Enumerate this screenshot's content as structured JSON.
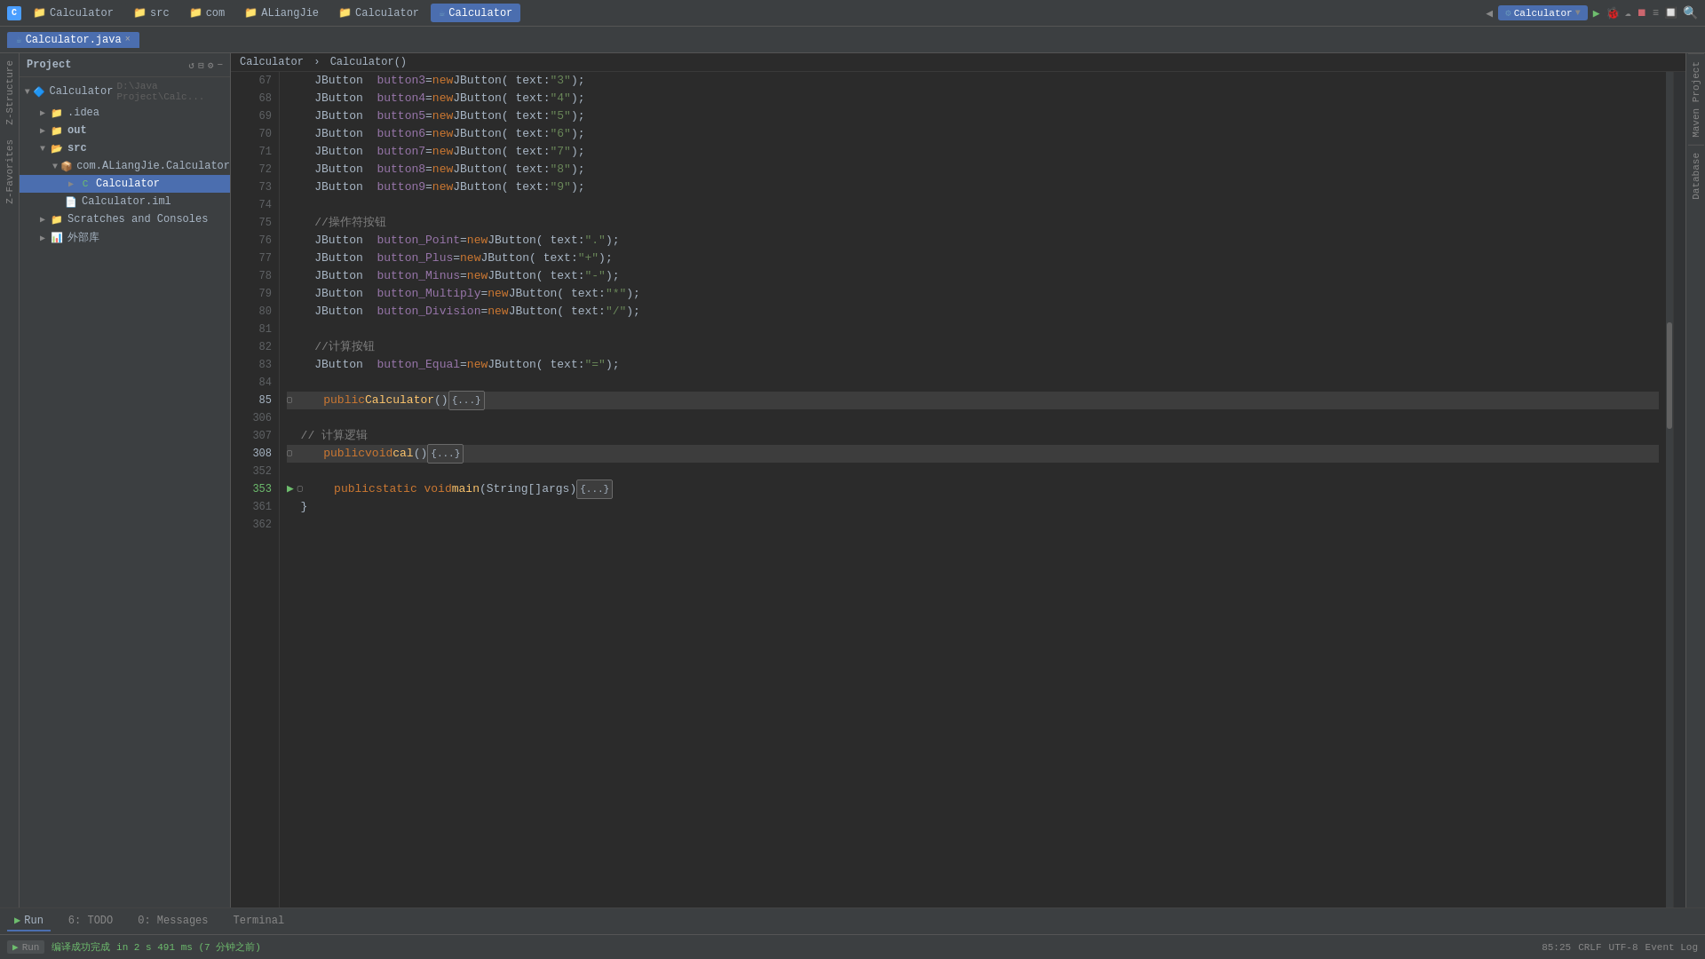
{
  "topbar": {
    "app_icon": "C",
    "tabs": [
      {
        "label": "Calculator",
        "type": "folder",
        "active": false
      },
      {
        "label": "src",
        "type": "folder",
        "active": false
      },
      {
        "label": "com",
        "type": "folder",
        "active": false
      },
      {
        "label": "ALiangJie",
        "type": "folder",
        "active": false
      },
      {
        "label": "Calculator",
        "type": "folder",
        "active": false
      },
      {
        "label": "Calculator",
        "type": "file",
        "active": true
      }
    ],
    "run_config": "Calculator",
    "run_btn": "▶",
    "debug_btn": "🐞"
  },
  "toolbar": {
    "file_tab": "Calculator.java",
    "close": "×"
  },
  "sidebar": {
    "header": "Project",
    "tree": [
      {
        "level": 0,
        "label": "Calculator  D:\\Java Project\\Calc...",
        "icon": "project",
        "expanded": true
      },
      {
        "level": 1,
        "label": ".idea",
        "icon": "folder",
        "expanded": false
      },
      {
        "level": 1,
        "label": "out",
        "icon": "folder",
        "expanded": false
      },
      {
        "level": 1,
        "label": "src",
        "icon": "folder",
        "expanded": true
      },
      {
        "level": 2,
        "label": "com.ALiangJie.Calculator",
        "icon": "package",
        "expanded": true
      },
      {
        "level": 3,
        "label": "Calculator",
        "icon": "class",
        "expanded": false
      },
      {
        "level": 3,
        "label": "Calculator.iml",
        "icon": "file",
        "expanded": false
      },
      {
        "level": 1,
        "label": "Scratches and Consoles",
        "icon": "folder",
        "expanded": false
      },
      {
        "level": 1,
        "label": "外部库",
        "icon": "lib",
        "expanded": false
      }
    ]
  },
  "code": {
    "lines": [
      {
        "num": "67",
        "content": [
          {
            "t": "plain",
            "v": "    JButton  "
          },
          {
            "t": "var",
            "v": "button3"
          },
          {
            "t": "plain",
            "v": "= "
          },
          {
            "t": "kw",
            "v": "new"
          },
          {
            "t": "plain",
            "v": " JButton( text: "
          },
          {
            "t": "str",
            "v": "\"3\""
          },
          {
            "t": "plain",
            "v": ");"
          }
        ]
      },
      {
        "num": "68",
        "content": [
          {
            "t": "plain",
            "v": "    JButton  "
          },
          {
            "t": "var",
            "v": "button4"
          },
          {
            "t": "plain",
            "v": "= "
          },
          {
            "t": "kw",
            "v": "new"
          },
          {
            "t": "plain",
            "v": " JButton( text: "
          },
          {
            "t": "str",
            "v": "\"4\""
          },
          {
            "t": "plain",
            "v": ");"
          }
        ]
      },
      {
        "num": "69",
        "content": [
          {
            "t": "plain",
            "v": "    JButton  "
          },
          {
            "t": "var",
            "v": "button5"
          },
          {
            "t": "plain",
            "v": "= "
          },
          {
            "t": "kw",
            "v": "new"
          },
          {
            "t": "plain",
            "v": " JButton( text: "
          },
          {
            "t": "str",
            "v": "\"5\""
          },
          {
            "t": "plain",
            "v": ");"
          }
        ]
      },
      {
        "num": "70",
        "content": [
          {
            "t": "plain",
            "v": "    JButton  "
          },
          {
            "t": "var",
            "v": "button6"
          },
          {
            "t": "plain",
            "v": "= "
          },
          {
            "t": "kw",
            "v": "new"
          },
          {
            "t": "plain",
            "v": " JButton( text: "
          },
          {
            "t": "str",
            "v": "\"6\""
          },
          {
            "t": "plain",
            "v": ");"
          }
        ]
      },
      {
        "num": "71",
        "content": [
          {
            "t": "plain",
            "v": "    JButton  "
          },
          {
            "t": "var",
            "v": "button7"
          },
          {
            "t": "plain",
            "v": "= "
          },
          {
            "t": "kw",
            "v": "new"
          },
          {
            "t": "plain",
            "v": " JButton( text: "
          },
          {
            "t": "str",
            "v": "\"7\""
          },
          {
            "t": "plain",
            "v": ");"
          }
        ]
      },
      {
        "num": "72",
        "content": [
          {
            "t": "plain",
            "v": "    JButton  "
          },
          {
            "t": "var",
            "v": "button8"
          },
          {
            "t": "plain",
            "v": "= "
          },
          {
            "t": "kw",
            "v": "new"
          },
          {
            "t": "plain",
            "v": " JButton( text: "
          },
          {
            "t": "str",
            "v": "\"8\""
          },
          {
            "t": "plain",
            "v": ");"
          }
        ]
      },
      {
        "num": "73",
        "content": [
          {
            "t": "plain",
            "v": "    JButton  "
          },
          {
            "t": "var",
            "v": "button9"
          },
          {
            "t": "plain",
            "v": "= "
          },
          {
            "t": "kw",
            "v": "new"
          },
          {
            "t": "plain",
            "v": " JButton( text: "
          },
          {
            "t": "str",
            "v": "\"9\""
          },
          {
            "t": "plain",
            "v": ");"
          }
        ]
      },
      {
        "num": "74",
        "content": []
      },
      {
        "num": "75",
        "content": [
          {
            "t": "comment",
            "v": "    //操作符按钮"
          }
        ]
      },
      {
        "num": "76",
        "content": [
          {
            "t": "plain",
            "v": "    JButton  "
          },
          {
            "t": "var",
            "v": "button_Point"
          },
          {
            "t": "plain",
            "v": "="
          },
          {
            "t": "kw",
            "v": "new"
          },
          {
            "t": "plain",
            "v": " JButton( text: "
          },
          {
            "t": "str",
            "v": "\".\""
          },
          {
            "t": "plain",
            "v": ");"
          }
        ]
      },
      {
        "num": "77",
        "content": [
          {
            "t": "plain",
            "v": "    JButton  "
          },
          {
            "t": "var",
            "v": "button_Plus"
          },
          {
            "t": "plain",
            "v": "="
          },
          {
            "t": "kw",
            "v": "new"
          },
          {
            "t": "plain",
            "v": " JButton( text: "
          },
          {
            "t": "str",
            "v": "\"+\""
          },
          {
            "t": "plain",
            "v": ");"
          }
        ]
      },
      {
        "num": "78",
        "content": [
          {
            "t": "plain",
            "v": "    JButton  "
          },
          {
            "t": "var",
            "v": "button_Minus"
          },
          {
            "t": "plain",
            "v": "="
          },
          {
            "t": "kw",
            "v": "new"
          },
          {
            "t": "plain",
            "v": " JButton( text: "
          },
          {
            "t": "str",
            "v": "\"-\""
          },
          {
            "t": "plain",
            "v": ");"
          }
        ]
      },
      {
        "num": "79",
        "content": [
          {
            "t": "plain",
            "v": "    JButton  "
          },
          {
            "t": "var",
            "v": "button_Multiply"
          },
          {
            "t": "plain",
            "v": "="
          },
          {
            "t": "kw",
            "v": "new"
          },
          {
            "t": "plain",
            "v": " JButton( text: "
          },
          {
            "t": "str",
            "v": "\"*\""
          },
          {
            "t": "plain",
            "v": ");"
          }
        ]
      },
      {
        "num": "80",
        "content": [
          {
            "t": "plain",
            "v": "    JButton  "
          },
          {
            "t": "var",
            "v": "button_Division"
          },
          {
            "t": "plain",
            "v": "="
          },
          {
            "t": "kw",
            "v": "new"
          },
          {
            "t": "plain",
            "v": " JButton( text: "
          },
          {
            "t": "str",
            "v": "\"/\""
          },
          {
            "t": "plain",
            "v": ");"
          }
        ]
      },
      {
        "num": "81",
        "content": []
      },
      {
        "num": "82",
        "content": [
          {
            "t": "comment",
            "v": "    //计算按钮"
          }
        ]
      },
      {
        "num": "83",
        "content": [
          {
            "t": "plain",
            "v": "    JButton  "
          },
          {
            "t": "var",
            "v": "button_Equal"
          },
          {
            "t": "plain",
            "v": "="
          },
          {
            "t": "kw",
            "v": "new"
          },
          {
            "t": "plain",
            "v": " JButton( text: "
          },
          {
            "t": "str",
            "v": "\"=\""
          },
          {
            "t": "plain",
            "v": ");"
          }
        ]
      },
      {
        "num": "84",
        "content": []
      },
      {
        "num": "85",
        "content": "collapsed_constructor",
        "highlighted": true
      },
      {
        "num": "306",
        "content": []
      },
      {
        "num": "307",
        "content": [
          {
            "t": "comment",
            "v": "  // 计算逻辑"
          }
        ]
      },
      {
        "num": "308",
        "content": "collapsed_cal",
        "highlighted": true
      },
      {
        "num": "352",
        "content": []
      },
      {
        "num": "353",
        "content": "run_main"
      },
      {
        "num": "361",
        "content": [
          {
            "t": "plain",
            "v": "  }"
          }
        ]
      },
      {
        "num": "362",
        "content": []
      }
    ]
  },
  "breadcrumb": {
    "parts": [
      "Calculator",
      "Calculator()"
    ]
  },
  "bottom_tabs": [
    {
      "label": "▶ Run",
      "active": true
    },
    {
      "label": "6: TODO",
      "active": false
    },
    {
      "label": "0: Messages",
      "active": false
    },
    {
      "label": "Terminal",
      "active": false
    }
  ],
  "status_bar": {
    "status_msg": "编译成功完成 in 2 s 491 ms (7 分钟之前)",
    "position": "85:25",
    "line_sep": "CRLF",
    "encoding": "UTF-8",
    "event_log": "Event Log"
  },
  "right_tabs": [
    "Maven Project",
    "Database"
  ],
  "left_vtabs": [
    "Z-Structure",
    "Z-Favorites"
  ]
}
